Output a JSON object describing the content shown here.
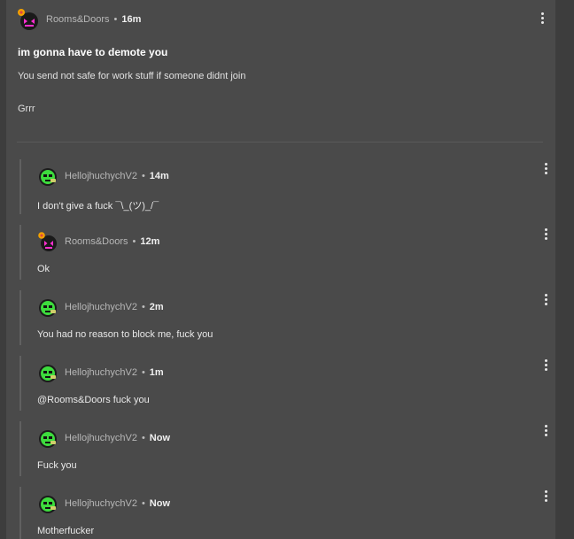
{
  "post": {
    "author": "Rooms&Doors",
    "time": "16m",
    "title": "im gonna have to demote you",
    "body_line1": "You send not safe for work stuff if someone didnt join",
    "body_line2": "Grrr"
  },
  "separator": "•",
  "replies": [
    {
      "author": "HellojhuchychV2",
      "time": "14m",
      "text": "I don't give a fuck ¯\\_(ツ)_/¯"
    },
    {
      "author": "Rooms&Doors",
      "time": "12m",
      "text": "Ok"
    },
    {
      "author": "HellojhuchychV2",
      "time": "2m",
      "text": "You had no reason to block me, fuck you"
    },
    {
      "author": "HellojhuchychV2",
      "time": "1m",
      "text": "@Rooms&Doors fuck you"
    },
    {
      "author": "HellojhuchychV2",
      "time": "Now",
      "text": "Fuck you"
    },
    {
      "author": "HellojhuchychV2",
      "time": "Now",
      "text": "Motherfucker"
    }
  ],
  "colors": {
    "card_bg": "#4a4a4a",
    "page_bg": "#3a3a3a",
    "avatar_green": "#3ddc3d",
    "avatar_pink": "#ff2fd0",
    "badge_orange": "#f2a100"
  }
}
